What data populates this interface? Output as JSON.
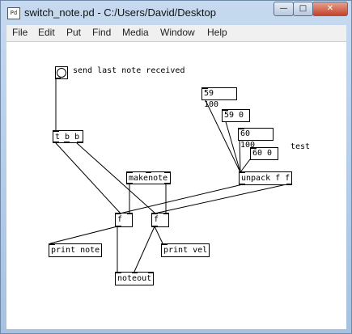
{
  "window": {
    "title": "switch_note.pd  - C:/Users/David/Desktop",
    "app_icon_text": "Pd",
    "controls": {
      "minimize": "—",
      "maximize": "□",
      "close": "✕"
    }
  },
  "menu": [
    "File",
    "Edit",
    "Put",
    "Find",
    "Media",
    "Window",
    "Help"
  ],
  "patch": {
    "comments": {
      "bang_label": "send last note received",
      "test": "test"
    },
    "objects": {
      "trigger": "t b b",
      "makenote": "makenote",
      "float_note": "f",
      "float_vel": "f",
      "print_note": "print note",
      "print_vel": "print vel",
      "noteout": "noteout",
      "unpack": "unpack f f"
    },
    "messages": [
      "59 100",
      "59 0",
      "60 100",
      "60 0"
    ]
  }
}
